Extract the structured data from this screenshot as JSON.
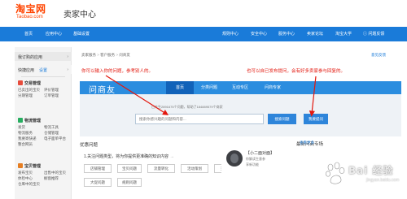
{
  "header": {
    "logo_main": "淘宝网",
    "logo_sub": "Taobao.com",
    "title": "卖家中心"
  },
  "topnav": {
    "left_items": [
      "首页",
      "应用中心",
      "基础设置"
    ],
    "right_items": [
      "规则中心",
      "安全中心",
      "服务中心",
      "卖家论坛",
      "淘宝大学",
      "问题反馈"
    ]
  },
  "sidebar": {
    "my_apps": "我订购的应用",
    "quick_apps": "快捷应用",
    "settings": "设置",
    "trade": {
      "title": "交易管理",
      "links": [
        "已卖出的宝贝",
        "评价管理",
        "分期管理",
        "订单管理"
      ]
    },
    "logistics": {
      "title": "物流管理",
      "links": [
        "发货",
        "物流工具",
        "物流服务",
        "仓储管理",
        "我要寄快递",
        "电子面单平台",
        "整合网员"
      ]
    },
    "goods": {
      "title": "宝贝管理",
      "links": [
        "发布宝贝",
        "出售中的宝贝",
        "体检中心",
        "橱窗推荐",
        "仓库中的宝贝"
      ]
    }
  },
  "breadcrumb": {
    "items": [
      "卖家服务",
      "客户服务",
      "问商友"
    ],
    "separator": ">"
  },
  "feedback": "意见反馈",
  "banner": {
    "logo": "问商友",
    "tabs": [
      "首页",
      "分类问题",
      "互动专区",
      "问商专家"
    ],
    "active_tab": 0
  },
  "search": {
    "hint": "已产生2891675个问题，帮助了184889579个商家",
    "placeholder": "搜索你感兴趣的问题和内容...",
    "search_button": "搜索问题",
    "ask_button": "我要提问"
  },
  "annotations": {
    "left": "你可以输入你的问题，参考别人的。",
    "right": "也可以自已发布提问，会有好多卖家参与回复的。"
  },
  "content": {
    "section_title": "优惠问题",
    "type_line": "1.关注问题类型，将为你提供更准确的知识内容",
    "tags": [
      "店铺管理",
      "宝贝问题",
      "流量转化",
      "活动策划",
      "交易纠纷",
      "大促问题",
      "规则问题"
    ],
    "experts_title": "最新问商专场",
    "experts_link": "查看更多"
  },
  "expert": {
    "name": "【小二面对面】",
    "desc": "你解读生意参",
    "desc2": "享新功能"
  },
  "watermark": {
    "text": "Bai 经验",
    "sub": "jingyan.baidu.com"
  },
  "colors": {
    "brand_orange": "#ff4400",
    "nav_blue": "#1a7bd9",
    "banner_blue": "#2b8ddf",
    "active_tab_blue": "#1162b9",
    "button_blue": "#2e85da",
    "annotation_red": "#e3170d"
  }
}
